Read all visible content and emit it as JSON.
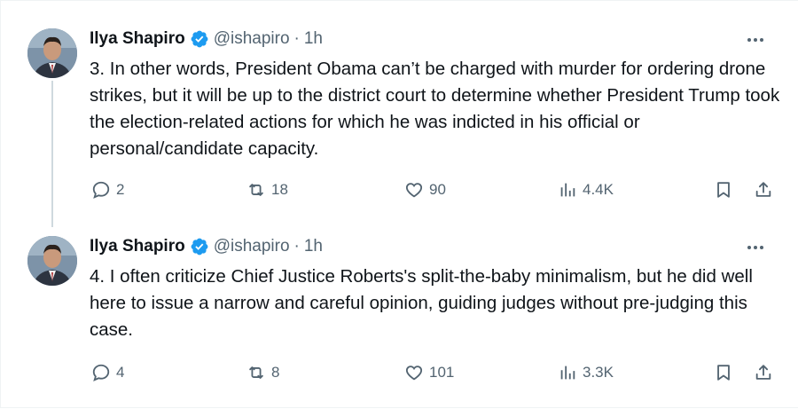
{
  "tweets": [
    {
      "author_name": "Ilya Shapiro",
      "handle": "@ishapiro",
      "separator": "·",
      "time": "1h",
      "text": "3. In other words, President Obama can’t be charged with murder for ordering drone strikes, but it will be up to the district court to determine whether President Trump took the election-related actions for which he was indicted in his official or personal/candidate capacity.",
      "replies": "2",
      "reposts": "18",
      "likes": "90",
      "views": "4.4K"
    },
    {
      "author_name": "Ilya Shapiro",
      "handle": "@ishapiro",
      "separator": "·",
      "time": "1h",
      "text": "4. I often criticize Chief Justice Roberts's split-the-baby minimalism, but he did well here to issue a narrow and careful opinion, guiding judges without pre-judging this case.",
      "replies": "4",
      "reposts": "8",
      "likes": "101",
      "views": "3.3K"
    }
  ],
  "icons": {
    "verified": "verified-badge-icon",
    "more": "more-options-icon",
    "reply": "reply-icon",
    "repost": "repost-icon",
    "like": "like-icon",
    "views": "views-icon",
    "bookmark": "bookmark-icon",
    "share": "share-icon"
  },
  "colors": {
    "verified_blue": "#1d9bf0",
    "secondary_text": "#536471",
    "thread_line": "#cfd9de"
  }
}
